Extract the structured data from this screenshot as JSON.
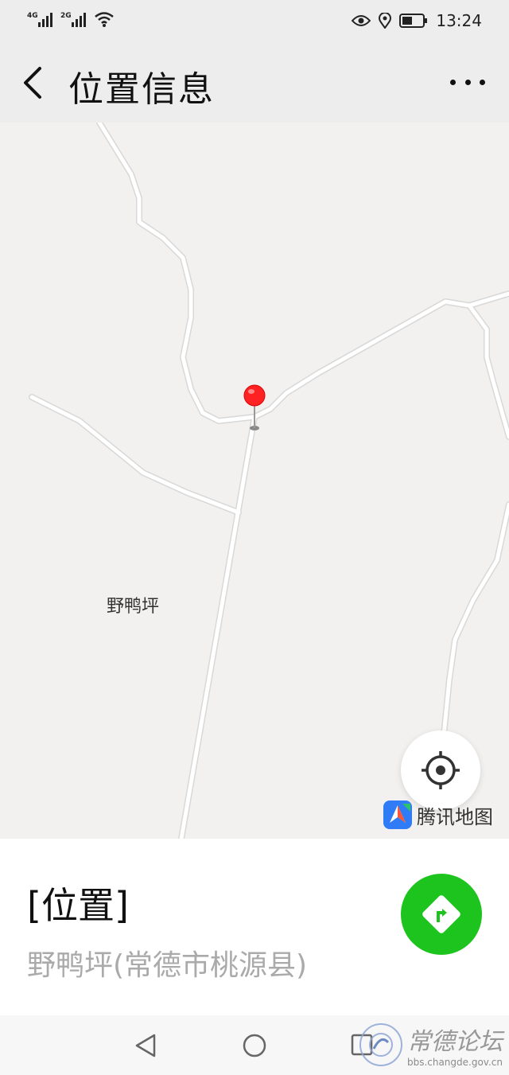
{
  "status_bar": {
    "network1": "4G",
    "network2": "2G",
    "time": "13:24"
  },
  "app_bar": {
    "title": "位置信息"
  },
  "map": {
    "place_label": "野鸭坪",
    "provider": "腾讯地图"
  },
  "location": {
    "title": "[位置]",
    "address": "野鸭坪(常德市桃源县)"
  },
  "watermark": {
    "title": "常德论坛",
    "url": "bbs.changde.gov.cn"
  },
  "colors": {
    "pin_red": "#ff2222",
    "nav_green": "#1ec41e",
    "map_bg": "#f2f1ef",
    "road_fill": "#ffffff",
    "road_edge": "#d8d8d8"
  }
}
